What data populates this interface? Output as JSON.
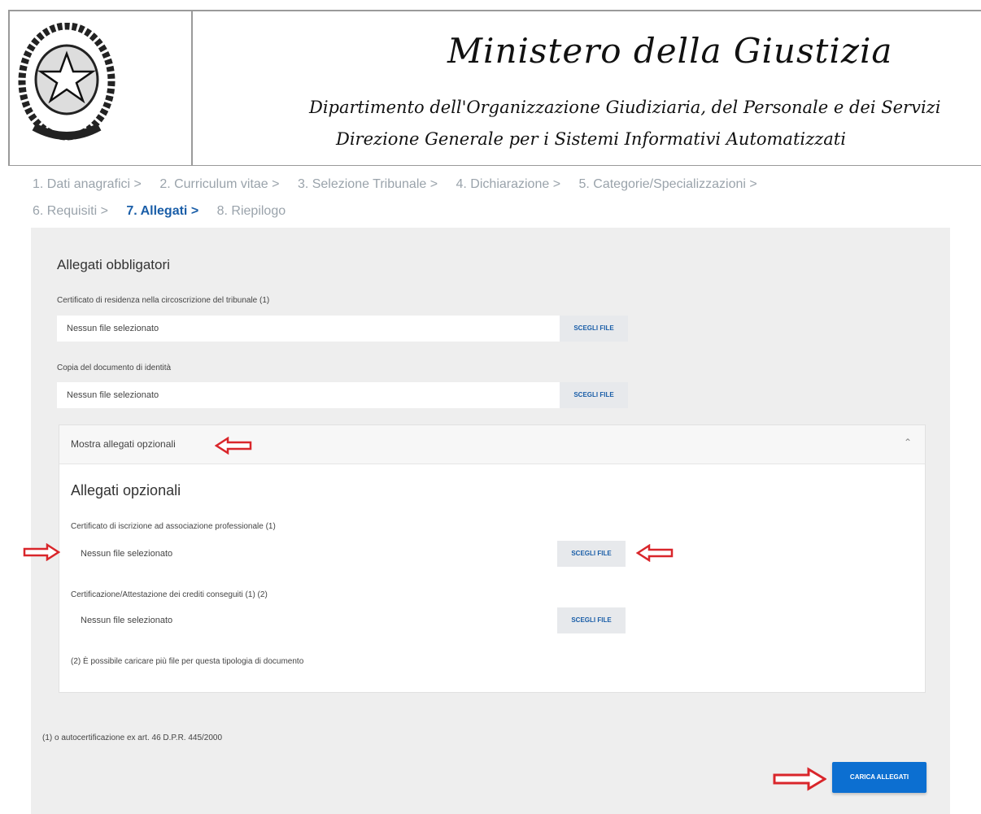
{
  "header": {
    "title": "Ministero della Giustizia",
    "department": "Dipartimento dell'Organizzazione Giudiziaria, del Personale e dei Servizi",
    "direction": "Direzione Generale per i Sistemi Informativi Automatizzati",
    "emblem_icon": "italian-republic-emblem-icon"
  },
  "steps": [
    {
      "label": "1. Dati anagrafici >"
    },
    {
      "label": "2. Curriculum vitae >"
    },
    {
      "label": "3. Selezione Tribunale >"
    },
    {
      "label": "4. Dichiarazione >"
    },
    {
      "label": "5. Categorie/Specializzazioni >"
    },
    {
      "label": "6. Requisiti >"
    },
    {
      "label": "7. Allegati >"
    },
    {
      "label": "8. Riepilogo"
    }
  ],
  "active_step": "7. Allegati >",
  "mandatory": {
    "title": "Allegati obbligatori",
    "fields": [
      {
        "label": "Certificato di residenza nella circoscrizione del tribunale (1)",
        "value": "Nessun file selezionato",
        "button": "SCEGLI FILE"
      },
      {
        "label": "Copia del documento di identità",
        "value": "Nessun file selezionato",
        "button": "SCEGLI FILE"
      }
    ]
  },
  "optional": {
    "toggle_label": "Mostra allegati opzionali",
    "chevron_icon": "chevron-up-icon",
    "title": "Allegati opzionali",
    "fields": [
      {
        "label": "Certificato di iscrizione ad associazione professionale (1)",
        "value": "Nessun file selezionato",
        "button": "SCEGLI FILE"
      },
      {
        "label": "Certificazione/Attestazione dei crediti conseguiti (1) (2)",
        "value": "Nessun file selezionato",
        "button": "SCEGLI FILE"
      }
    ],
    "note": "(2) È possibile caricare più file per questa tipologia di documento"
  },
  "footnote": "(1) o autocertificazione ex art. 46 D.P.R. 445/2000",
  "submit_label": "CARICA ALLEGATI",
  "colors": {
    "active_step": "#1a5ea8",
    "primary_button": "#0c6fd1",
    "annotation_arrow": "#d9262b"
  }
}
